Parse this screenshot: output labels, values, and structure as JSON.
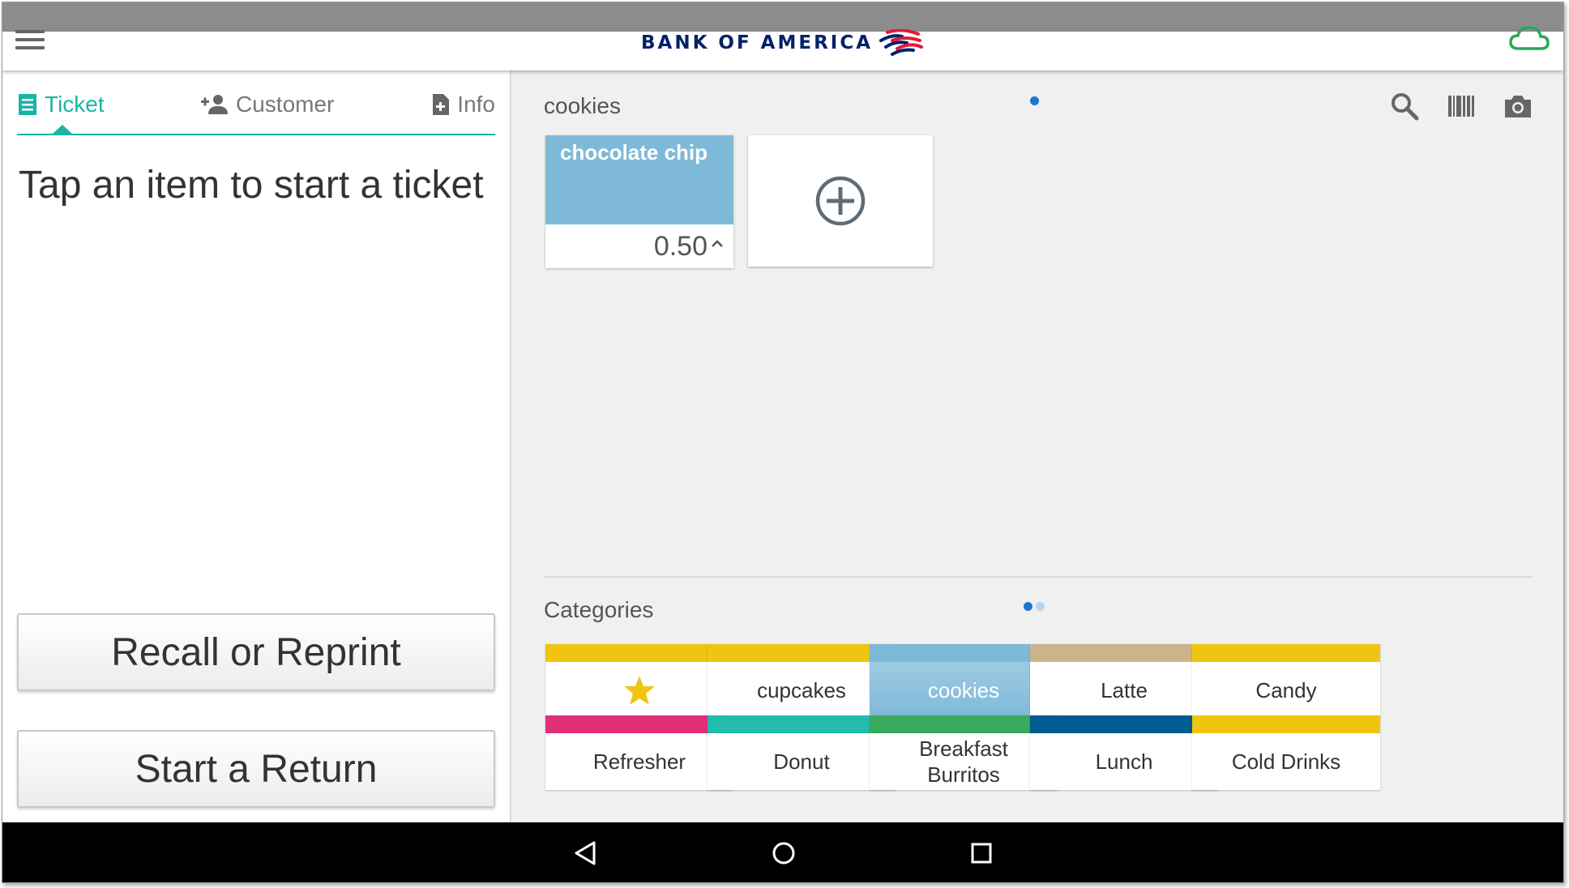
{
  "appbar": {
    "logo_text": "BANK OF AMERICA",
    "colors": {
      "brand_blue": "#012169",
      "brand_red": "#e31837",
      "cloud": "#2aa85a"
    }
  },
  "tabs": [
    {
      "label": "Ticket",
      "icon": "receipt-icon",
      "selected": true
    },
    {
      "label": "Customer",
      "icon": "person-add-icon",
      "selected": false
    },
    {
      "label": "Info",
      "icon": "note-add-icon",
      "selected": false
    }
  ],
  "ticket": {
    "empty_hint": "Tap an item to start a ticket",
    "recall_label": "Recall or Reprint",
    "return_label": "Start a Return"
  },
  "items_panel": {
    "group_title": "cookies",
    "page_count": 1,
    "current_page": 1,
    "items": [
      {
        "name": "chocolate chip",
        "price": "0.50",
        "color": "#7eb9d8"
      }
    ]
  },
  "categories_panel": {
    "title": "Categories",
    "page_count": 2,
    "current_page": 1,
    "items": [
      {
        "label": "",
        "icon": "star-icon",
        "color": "#f1c40f",
        "selected": false
      },
      {
        "label": "cupcakes",
        "color": "#f1c40f",
        "selected": false
      },
      {
        "label": "cookies",
        "color": "#7eb9d8",
        "selected": true
      },
      {
        "label": "Latte",
        "color": "#cdb38b",
        "selected": false
      },
      {
        "label": "Candy",
        "color": "#f1c40f",
        "selected": false
      },
      {
        "label": "Refresher",
        "color": "#e0307a",
        "selected": false
      },
      {
        "label": "Donut",
        "color": "#22bcad",
        "selected": false
      },
      {
        "label": "Breakfast Burritos",
        "color": "#3aaa5e",
        "selected": false
      },
      {
        "label": "Lunch",
        "color": "#005b91",
        "selected": false
      },
      {
        "label": "Cold Drinks",
        "color": "#f1c40f",
        "selected": false
      }
    ]
  },
  "accent_color": "#1ab4a4"
}
